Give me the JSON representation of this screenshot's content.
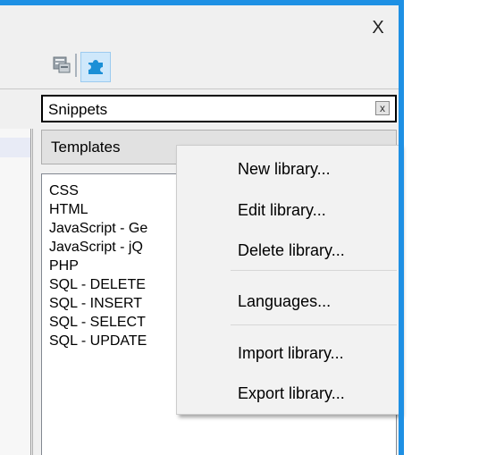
{
  "window": {
    "close_label": "X"
  },
  "toolbar": {
    "icon1": "form-icon",
    "icon2": "puzzle-icon",
    "accent_color": "#1e90e4"
  },
  "snippets_field": {
    "value": "Snippets",
    "clear_label": "x"
  },
  "templates_dropdown": {
    "value": "Templates"
  },
  "library_list": {
    "items": [
      "CSS",
      "HTML",
      "JavaScript - Ge",
      "JavaScript - jQ",
      "PHP",
      "SQL - DELETE",
      "SQL - INSERT",
      "SQL - SELECT",
      "SQL - UPDATE"
    ]
  },
  "context_menu": {
    "items": [
      {
        "label": "New library..."
      },
      {
        "label": "Edit library..."
      },
      {
        "label": "Delete library..."
      },
      {
        "label": "Languages..."
      },
      {
        "label": "Import library..."
      },
      {
        "label": "Export library..."
      }
    ]
  }
}
